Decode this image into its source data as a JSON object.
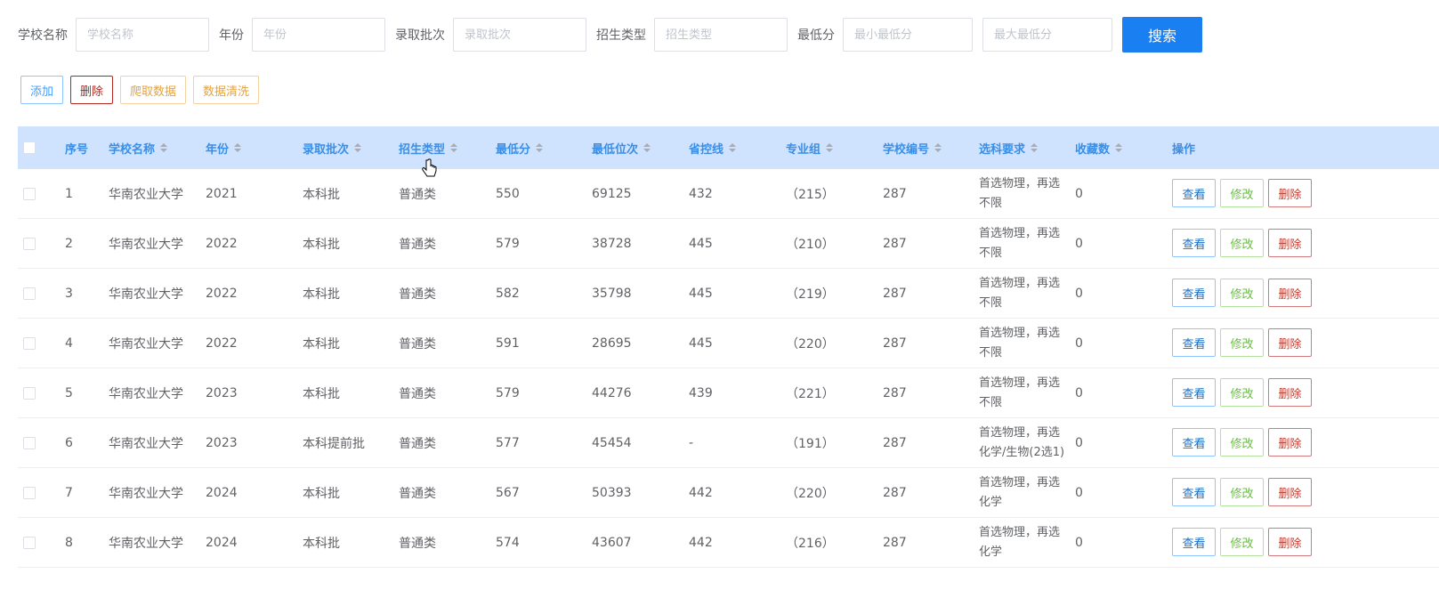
{
  "search": {
    "fields": [
      {
        "label": "学校名称",
        "placeholder": "学校名称"
      },
      {
        "label": "年份",
        "placeholder": "年份"
      },
      {
        "label": "录取批次",
        "placeholder": "录取批次"
      },
      {
        "label": "招生类型",
        "placeholder": "招生类型"
      },
      {
        "label": "最低分",
        "placeholder": "最小最低分"
      },
      {
        "label": "",
        "placeholder": "最大最低分"
      }
    ],
    "button": "搜索"
  },
  "toolbar": {
    "add": "添加",
    "delete": "删除",
    "crawl": "爬取数据",
    "clean": "数据清洗"
  },
  "table": {
    "headers": [
      "序号",
      "学校名称",
      "年份",
      "录取批次",
      "招生类型",
      "最低分",
      "最低位次",
      "省控线",
      "专业组",
      "学校编号",
      "选科要求",
      "收藏数",
      "操作"
    ],
    "actions": {
      "view": "查看",
      "edit": "修改",
      "delete": "删除"
    },
    "rows": [
      [
        "1",
        "华南农业大学",
        "2021",
        "本科批",
        "普通类",
        "550",
        "69125",
        "432",
        "（215）",
        "287",
        "首选物理，再选不限",
        "0"
      ],
      [
        "2",
        "华南农业大学",
        "2022",
        "本科批",
        "普通类",
        "579",
        "38728",
        "445",
        "（210）",
        "287",
        "首选物理，再选不限",
        "0"
      ],
      [
        "3",
        "华南农业大学",
        "2022",
        "本科批",
        "普通类",
        "582",
        "35798",
        "445",
        "（219）",
        "287",
        "首选物理，再选不限",
        "0"
      ],
      [
        "4",
        "华南农业大学",
        "2022",
        "本科批",
        "普通类",
        "591",
        "28695",
        "445",
        "（220）",
        "287",
        "首选物理，再选不限",
        "0"
      ],
      [
        "5",
        "华南农业大学",
        "2023",
        "本科批",
        "普通类",
        "579",
        "44276",
        "439",
        "（221）",
        "287",
        "首选物理，再选不限",
        "0"
      ],
      [
        "6",
        "华南农业大学",
        "2023",
        "本科提前批",
        "普通类",
        "577",
        "45454",
        "-",
        "（191）",
        "287",
        "首选物理，再选化学/生物(2选1)",
        "0"
      ],
      [
        "7",
        "华南农业大学",
        "2024",
        "本科批",
        "普通类",
        "567",
        "50393",
        "442",
        "（220）",
        "287",
        "首选物理，再选化学",
        "0"
      ],
      [
        "8",
        "华南农业大学",
        "2024",
        "本科批",
        "普通类",
        "574",
        "43607",
        "442",
        "（216）",
        "287",
        "首选物理，再选化学",
        "0"
      ]
    ]
  },
  "colors": {
    "primary": "#1a7ff0",
    "header_bg": "#cfe3ff",
    "danger": "#b3261e",
    "warning": "#e6a23c",
    "success": "#67c23a"
  }
}
